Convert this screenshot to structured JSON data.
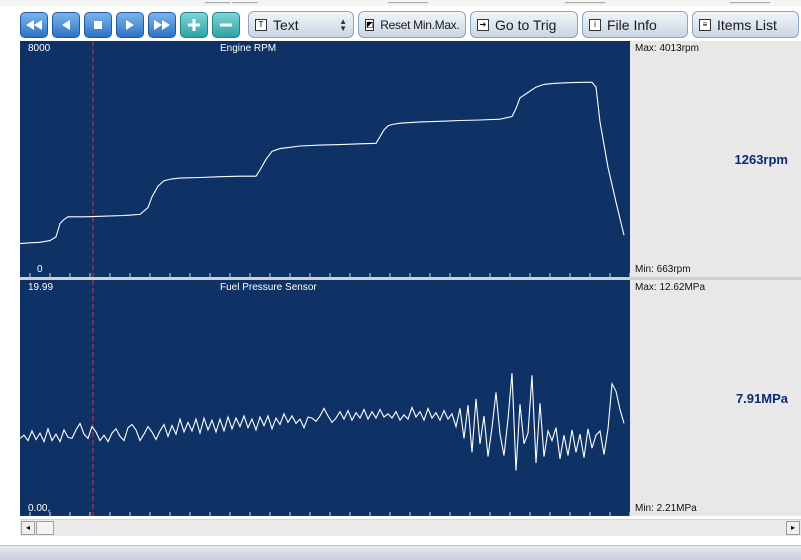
{
  "toolbar": {
    "text_label": "Text",
    "reset_label": "Reset Min.Max.",
    "gototrig_label": "Go to Trig",
    "fileinfo_label": "File Info",
    "itemslist_label": "Items List"
  },
  "graphs": [
    {
      "title": "Engine RPM",
      "y_top": "8000",
      "y_bottom": "0",
      "max_text": "Max:  4013rpm",
      "min_text": "Min:    663rpm",
      "current_value": "1263rpm"
    },
    {
      "title": "Fuel Pressure Sensor",
      "y_top": "19.99",
      "y_bottom": "0.00,",
      "max_text": "Max: 12.62MPa",
      "min_text": "Min:   2.21MPa",
      "current_value": "7.91MPa"
    }
  ],
  "chart_data": [
    {
      "type": "line",
      "title": "Engine RPM",
      "ylim": [
        0,
        8000
      ],
      "x": [
        0,
        5,
        10,
        15,
        18,
        20,
        22,
        24,
        26,
        28,
        32,
        40,
        52,
        60,
        64,
        66,
        69,
        72,
        76,
        80,
        90,
        100,
        110,
        118,
        120,
        123,
        126,
        130,
        135,
        140,
        150,
        160,
        170,
        178,
        180,
        182,
        184,
        186,
        190,
        200,
        210,
        220,
        230,
        240,
        246,
        248,
        250,
        254,
        258,
        262,
        266,
        270,
        276,
        282,
        286,
        288,
        290,
        294,
        298,
        302
      ],
      "values": [
        950,
        980,
        1000,
        1060,
        1200,
        1700,
        1850,
        1950,
        1950,
        1950,
        1950,
        1970,
        2000,
        2040,
        2300,
        2700,
        3100,
        3300,
        3370,
        3400,
        3420,
        3450,
        3470,
        3470,
        3700,
        4100,
        4400,
        4500,
        4550,
        4600,
        4630,
        4650,
        4680,
        4700,
        4950,
        5200,
        5350,
        5400,
        5450,
        5500,
        5520,
        5550,
        5570,
        5600,
        5700,
        6000,
        6400,
        6600,
        6800,
        6900,
        6930,
        6950,
        6970,
        6980,
        6980,
        6800,
        5500,
        3800,
        2500,
        1263
      ]
    },
    {
      "type": "line",
      "title": "Fuel Pressure Sensor",
      "ylim": [
        0,
        19.99
      ],
      "x": [
        0,
        2,
        4,
        6,
        8,
        10,
        12,
        14,
        16,
        18,
        20,
        22,
        24,
        26,
        28,
        30,
        32,
        34,
        36,
        38,
        40,
        42,
        44,
        46,
        48,
        50,
        52,
        54,
        56,
        58,
        60,
        62,
        64,
        66,
        68,
        70,
        72,
        74,
        76,
        78,
        80,
        82,
        84,
        86,
        88,
        90,
        92,
        94,
        96,
        98,
        100,
        102,
        104,
        106,
        108,
        110,
        112,
        114,
        116,
        118,
        120,
        122,
        124,
        126,
        128,
        130,
        132,
        134,
        136,
        138,
        140,
        142,
        144,
        146,
        148,
        150,
        152,
        154,
        156,
        158,
        160,
        162,
        164,
        166,
        168,
        170,
        172,
        174,
        176,
        178,
        180,
        182,
        184,
        186,
        188,
        190,
        192,
        194,
        196,
        198,
        200,
        202,
        204,
        206,
        208,
        210,
        212,
        214,
        216,
        218,
        220,
        222,
        224,
        226,
        228,
        230,
        232,
        234,
        236,
        238,
        240,
        242,
        244,
        246,
        248,
        250,
        252,
        254,
        256,
        258,
        260,
        262,
        264,
        266,
        268,
        270,
        272,
        274,
        276,
        278,
        280,
        282,
        284,
        286,
        288,
        290,
        292,
        294,
        296,
        298,
        300,
        302
      ],
      "values": [
        6.5,
        6.8,
        6.3,
        7.2,
        6.4,
        7.0,
        6.2,
        7.4,
        6.3,
        6.9,
        6.2,
        7.3,
        6.6,
        6.5,
        7.3,
        7.9,
        6.9,
        6.5,
        7.6,
        7.1,
        6.3,
        6.8,
        6.2,
        7.0,
        7.4,
        6.7,
        6.3,
        7.5,
        7.8,
        7.3,
        6.3,
        6.9,
        7.6,
        7.1,
        6.4,
        7.2,
        7.8,
        6.7,
        7.7,
        6.9,
        8.3,
        7.1,
        8.0,
        7.2,
        8.3,
        7.0,
        8.4,
        7.3,
        8.2,
        7.1,
        8.3,
        7.2,
        8.5,
        7.4,
        8.4,
        7.6,
        8.6,
        7.5,
        8.3,
        7.3,
        8.5,
        7.7,
        8.6,
        7.4,
        8.4,
        7.8,
        8.8,
        8.0,
        8.6,
        7.9,
        8.3,
        7.5,
        8.5,
        8.4,
        8.1,
        8.6,
        9.3,
        8.6,
        8.0,
        8.4,
        9.0,
        8.3,
        9.1,
        8.2,
        8.9,
        8.4,
        9.2,
        8.3,
        9.0,
        8.4,
        9.2,
        8.5,
        8.8,
        8.4,
        9.0,
        8.2,
        8.7,
        8.3,
        9.4,
        8.5,
        9.0,
        8.2,
        9.3,
        8.4,
        8.9,
        8.2,
        9.1,
        8.3,
        8.8,
        7.6,
        9.3,
        6.5,
        9.6,
        5.2,
        10.2,
        6.0,
        8.6,
        4.8,
        7.5,
        10.8,
        6.9,
        4.9,
        8.3,
        12.6,
        3.5,
        9.7,
        6.0,
        7.0,
        12.4,
        4.2,
        9.8,
        4.8,
        7.2,
        6.3,
        7.5,
        4.6,
        6.8,
        4.9,
        7.3,
        5.2,
        6.9,
        4.7,
        7.4,
        5.6,
        6.8,
        7.2,
        5.0,
        7.4,
        11.6,
        10.9,
        9.2,
        7.91
      ]
    }
  ]
}
